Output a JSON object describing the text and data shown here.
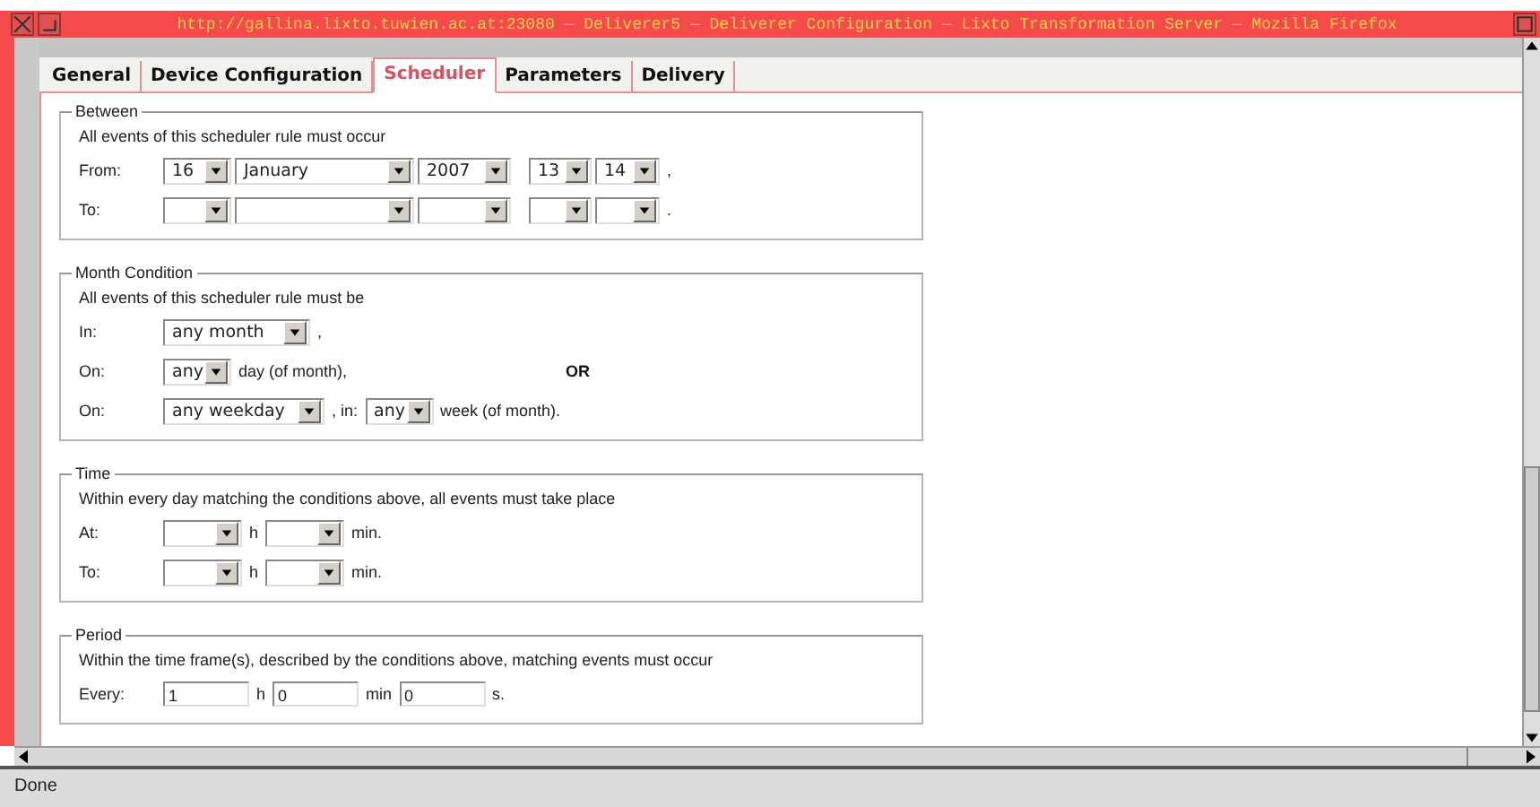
{
  "window": {
    "title": "http://gallina.lixto.tuwien.ac.at:23080 — Deliverer5 — Deliverer Configuration — Lixto Transformation Server — Mozilla Firefox"
  },
  "tabs": [
    {
      "label": "General",
      "selected": false
    },
    {
      "label": "Device Configuration",
      "selected": false
    },
    {
      "label": "Scheduler",
      "selected": true
    },
    {
      "label": "Parameters",
      "selected": false
    },
    {
      "label": "Delivery",
      "selected": false
    }
  ],
  "sections": [
    {
      "legend": "Between",
      "intro": "All events of this scheduler rule must occur",
      "rows": [
        {
          "label": "From:",
          "parts": [
            {
              "kind": "dayselect",
              "value": "16"
            },
            {
              "kind": "monthselect",
              "value": "January"
            },
            {
              "kind": "yearselect",
              "value": "2007"
            },
            {
              "kind": "gap"
            },
            {
              "kind": "hourselect",
              "value": "13"
            },
            {
              "kind": "minuteselect",
              "value": "14"
            },
            {
              "kind": "text",
              "text": ","
            }
          ]
        },
        {
          "label": "To:",
          "parts": [
            {
              "kind": "dayselect"
            },
            {
              "kind": "monthselect"
            },
            {
              "kind": "yearselect"
            },
            {
              "kind": "gap"
            },
            {
              "kind": "hourselect"
            },
            {
              "kind": "minuteselect"
            },
            {
              "kind": "text",
              "text": "."
            }
          ]
        }
      ]
    },
    {
      "legend": "Month Condition",
      "intro": "All events of this scheduler rule must be",
      "rows": [
        {
          "label": "In:",
          "parts": [
            {
              "kind": "wideselect",
              "value": "any month"
            },
            {
              "kind": "text",
              "text": ","
            }
          ]
        },
        {
          "label": "On:",
          "parts": [
            {
              "kind": "dayselect",
              "value": "any"
            },
            {
              "kind": "text",
              "text": "day (of month),"
            },
            {
              "kind": "note",
              "text": "OR"
            }
          ]
        },
        {
          "label": "On:",
          "parts": [
            {
              "kind": "weekdayselect",
              "value": "any weekday"
            },
            {
              "kind": "text",
              "text": ", in:"
            },
            {
              "kind": "dayselect",
              "value": "any"
            },
            {
              "kind": "text",
              "text": "week (of month)."
            }
          ]
        }
      ]
    },
    {
      "legend": "Time",
      "intro": "Within every day matching the conditions above, all events must take place",
      "rows": [
        {
          "label": "At:",
          "parts": [
            {
              "kind": "clockselect"
            },
            {
              "kind": "text",
              "text": "h"
            },
            {
              "kind": "clockselect"
            },
            {
              "kind": "text",
              "text": "min."
            }
          ]
        },
        {
          "label": "To:",
          "parts": [
            {
              "kind": "clockselect"
            },
            {
              "kind": "text",
              "text": "h"
            },
            {
              "kind": "clockselect"
            },
            {
              "kind": "text",
              "text": "min."
            }
          ]
        }
      ]
    },
    {
      "legend": "Period",
      "intro": "Within the time frame(s), described by the conditions above, matching events must occur",
      "rows": [
        {
          "label": "Every:",
          "parts": [
            {
              "kind": "input",
              "value": "1"
            },
            {
              "kind": "text",
              "text": "h"
            },
            {
              "kind": "input",
              "value": "0"
            },
            {
              "kind": "text",
              "text": "min"
            },
            {
              "kind": "input",
              "value": "0"
            },
            {
              "kind": "text",
              "text": "s."
            }
          ]
        }
      ]
    }
  ],
  "status_bar": {
    "text": "Done"
  }
}
